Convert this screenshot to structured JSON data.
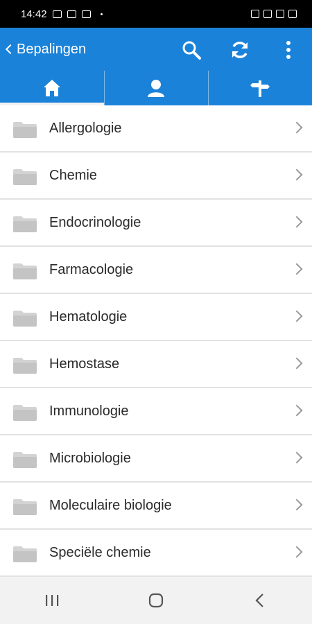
{
  "status_bar": {
    "time": "14:42"
  },
  "app_bar": {
    "title": "Bepalingen"
  },
  "tabs": [
    {
      "icon": "home-icon",
      "active": true
    },
    {
      "icon": "person-icon",
      "active": false
    },
    {
      "icon": "signpost-icon",
      "active": false
    }
  ],
  "categories": [
    {
      "label": "Allergologie"
    },
    {
      "label": "Chemie"
    },
    {
      "label": "Endocrinologie"
    },
    {
      "label": "Farmacologie"
    },
    {
      "label": "Hematologie"
    },
    {
      "label": "Hemostase"
    },
    {
      "label": "Immunologie"
    },
    {
      "label": "Microbiologie"
    },
    {
      "label": "Moleculaire biologie"
    },
    {
      "label": "Speciële chemie"
    }
  ],
  "colors": {
    "primary": "#1b82d9",
    "folder": "#d3d3d3",
    "chevron": "#9a9a9a"
  }
}
